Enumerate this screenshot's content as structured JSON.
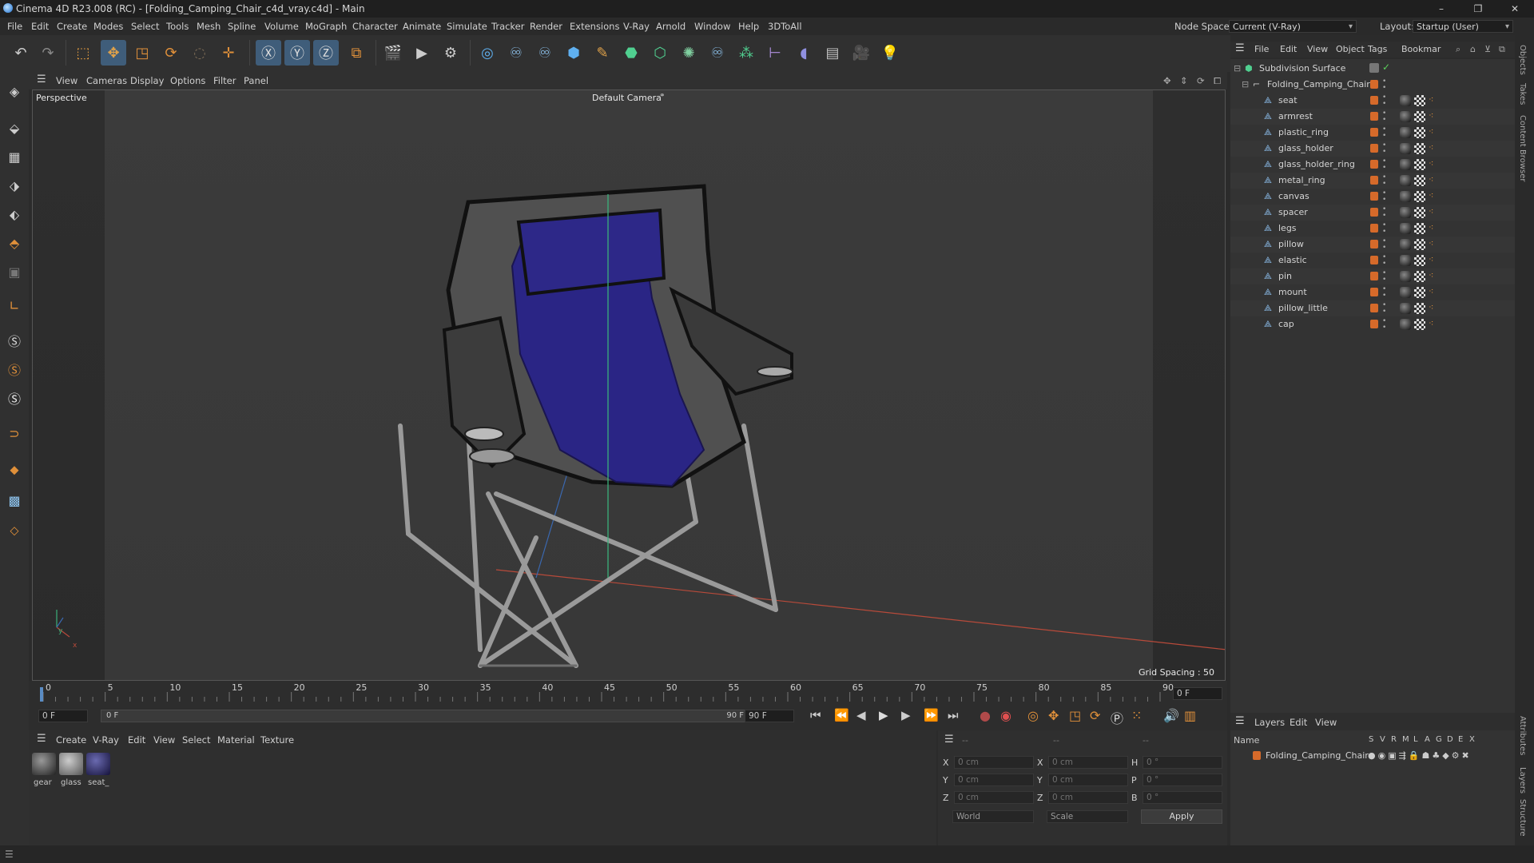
{
  "window": {
    "title": "Cinema 4D R23.008 (RC) - [Folding_Camping_Chair_c4d_vray.c4d] - Main",
    "controls": [
      "–",
      "❐",
      "✕"
    ]
  },
  "menubar": {
    "items": [
      "File",
      "Edit",
      "Create",
      "Modes",
      "Select",
      "Tools",
      "Mesh",
      "Spline",
      "Volume",
      "MoGraph",
      "Character",
      "Animate",
      "Simulate",
      "Tracker",
      "Render",
      "Extensions",
      "V-Ray",
      "Arnold",
      "Window",
      "Help",
      "3DToAll"
    ],
    "node_space_label": "Node Space:",
    "node_space_value": "Current (V-Ray)",
    "layout_label": "Layout:",
    "layout_value": "Startup (User)"
  },
  "viewport": {
    "menu": [
      "View",
      "Cameras",
      "Display",
      "Options",
      "Filter",
      "Panel"
    ],
    "view_name": "Perspective",
    "camera_name": "Default Camera",
    "grid_spacing": "Grid Spacing : 50 cm",
    "axis_y": "y",
    "axis_x": "x"
  },
  "timeline": {
    "ticks": [
      "0",
      "5",
      "10",
      "15",
      "20",
      "25",
      "30",
      "35",
      "40",
      "45",
      "50",
      "55",
      "60",
      "65",
      "70",
      "75",
      "80",
      "85",
      "90"
    ],
    "current_frame": "0 F",
    "start_frame": "0 F",
    "range_start": "0 F",
    "range_end": "90 F",
    "end_frame": "90 F"
  },
  "material_manager": {
    "menu": [
      "Create",
      "V-Ray",
      "Edit",
      "View",
      "Select",
      "Material",
      "Texture"
    ],
    "materials": [
      {
        "name": "gear"
      },
      {
        "name": "glass"
      },
      {
        "name": "seat_"
      }
    ]
  },
  "coordinates": {
    "header_left": "--",
    "header_mid": "--",
    "header_right": "--",
    "rows": [
      {
        "l1": "X",
        "v1": "0 cm",
        "l2": "X",
        "v2": "0 cm",
        "l3": "H",
        "v3": "0 °"
      },
      {
        "l1": "Y",
        "v1": "0 cm",
        "l2": "Y",
        "v2": "0 cm",
        "l3": "P",
        "v3": "0 °"
      },
      {
        "l1": "Z",
        "v1": "0 cm",
        "l2": "Z",
        "v2": "0 cm",
        "l3": "B",
        "v3": "0 °"
      }
    ],
    "mode": "World",
    "transform": "Scale",
    "apply": "Apply"
  },
  "object_manager": {
    "menu": [
      "File",
      "Edit",
      "View",
      "Object",
      "Tags",
      "Bookmar"
    ],
    "root": "Subdivision Surface",
    "group": "Folding_Camping_Chair",
    "objects": [
      "seat",
      "armrest",
      "plastic_ring",
      "glass_holder",
      "glass_holder_ring",
      "metal_ring",
      "canvas",
      "spacer",
      "legs",
      "pillow",
      "elastic",
      "pin",
      "mount",
      "pillow_little",
      "cap"
    ]
  },
  "layers": {
    "menu": [
      "Layers",
      "Edit",
      "View"
    ],
    "col_name": "Name",
    "cols": [
      "S",
      "V",
      "R",
      "M",
      "L",
      "A",
      "G",
      "D",
      "E",
      "X"
    ],
    "items": [
      "Folding_Camping_Chair"
    ]
  },
  "side_tabs": [
    "Objects",
    "Takes",
    "Content Browser",
    "Attributes",
    "Layers",
    "Structure"
  ],
  "colors": {
    "accent_orange": "#d66a2a",
    "selection_blue": "#3f5d7a",
    "seat_purple": "#2a2585"
  }
}
